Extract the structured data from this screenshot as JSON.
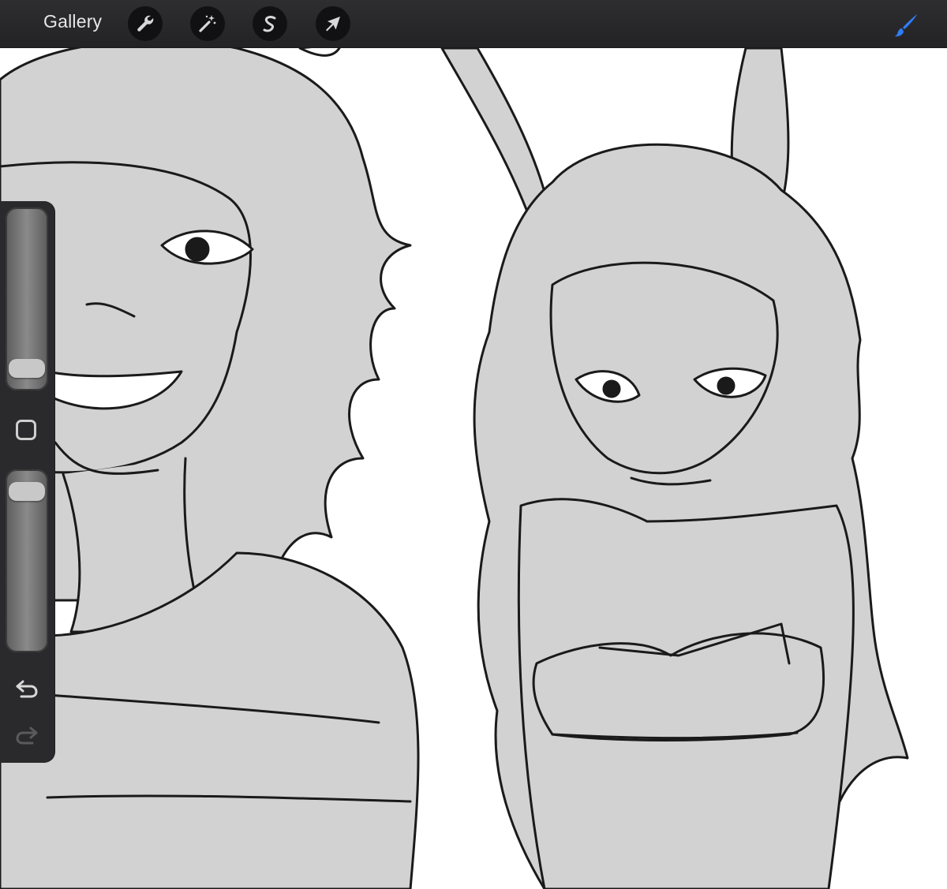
{
  "toolbar": {
    "gallery_label": "Gallery",
    "tools": [
      {
        "name": "actions",
        "icon": "wrench-icon"
      },
      {
        "name": "adjustments",
        "icon": "magic-wand-icon"
      },
      {
        "name": "selection",
        "icon": "selection-s-icon"
      },
      {
        "name": "transform",
        "icon": "arrow-cursor-icon"
      }
    ],
    "active_tool_icon": "brush-icon",
    "active_tool_color": "#2f7df6"
  },
  "sidebar": {
    "brush_size_icon": "brush-size-slider",
    "opacity_icon": "opacity-slider",
    "modify_icon": "square-modify-icon",
    "undo_icon": "undo-arrow-icon",
    "redo_icon": "redo-arrow-icon",
    "brush_size_level": 0.05,
    "opacity_level": 0.95
  },
  "canvas": {
    "background": "#ffffff",
    "fill_color": "#d2d2d2",
    "line_color": "#1a1a1a"
  }
}
